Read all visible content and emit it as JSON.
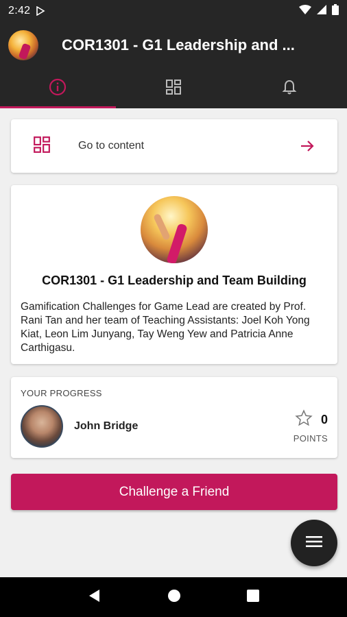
{
  "status_bar": {
    "time": "2:42"
  },
  "app_bar": {
    "title": "COR1301 - G1 Leadership and ..."
  },
  "tabs": [
    {
      "name": "info",
      "icon": "info-icon",
      "active": true
    },
    {
      "name": "content",
      "icon": "dashboard-icon",
      "active": false
    },
    {
      "name": "notifications",
      "icon": "bell-icon",
      "active": false
    }
  ],
  "content_link": {
    "label": "Go to content"
  },
  "course": {
    "title": "COR1301 - G1 Leadership and Team Building",
    "description": "Gamification Challenges for Game Lead are created by Prof. Rani Tan and her team of Teaching Assistants: Joel Koh Yong Kiat, Leon Lim Junyang, Tay Weng Yew and Patricia Anne Carthigasu."
  },
  "progress": {
    "label": "YOUR PROGRESS",
    "user_name": "John Bridge",
    "points_value": "0",
    "points_unit": "POINTS"
  },
  "challenge_button": {
    "label": "Challenge a Friend"
  },
  "colors": {
    "accent": "#c2185b",
    "app_bar": "#262626",
    "background": "#f0f0f0"
  }
}
